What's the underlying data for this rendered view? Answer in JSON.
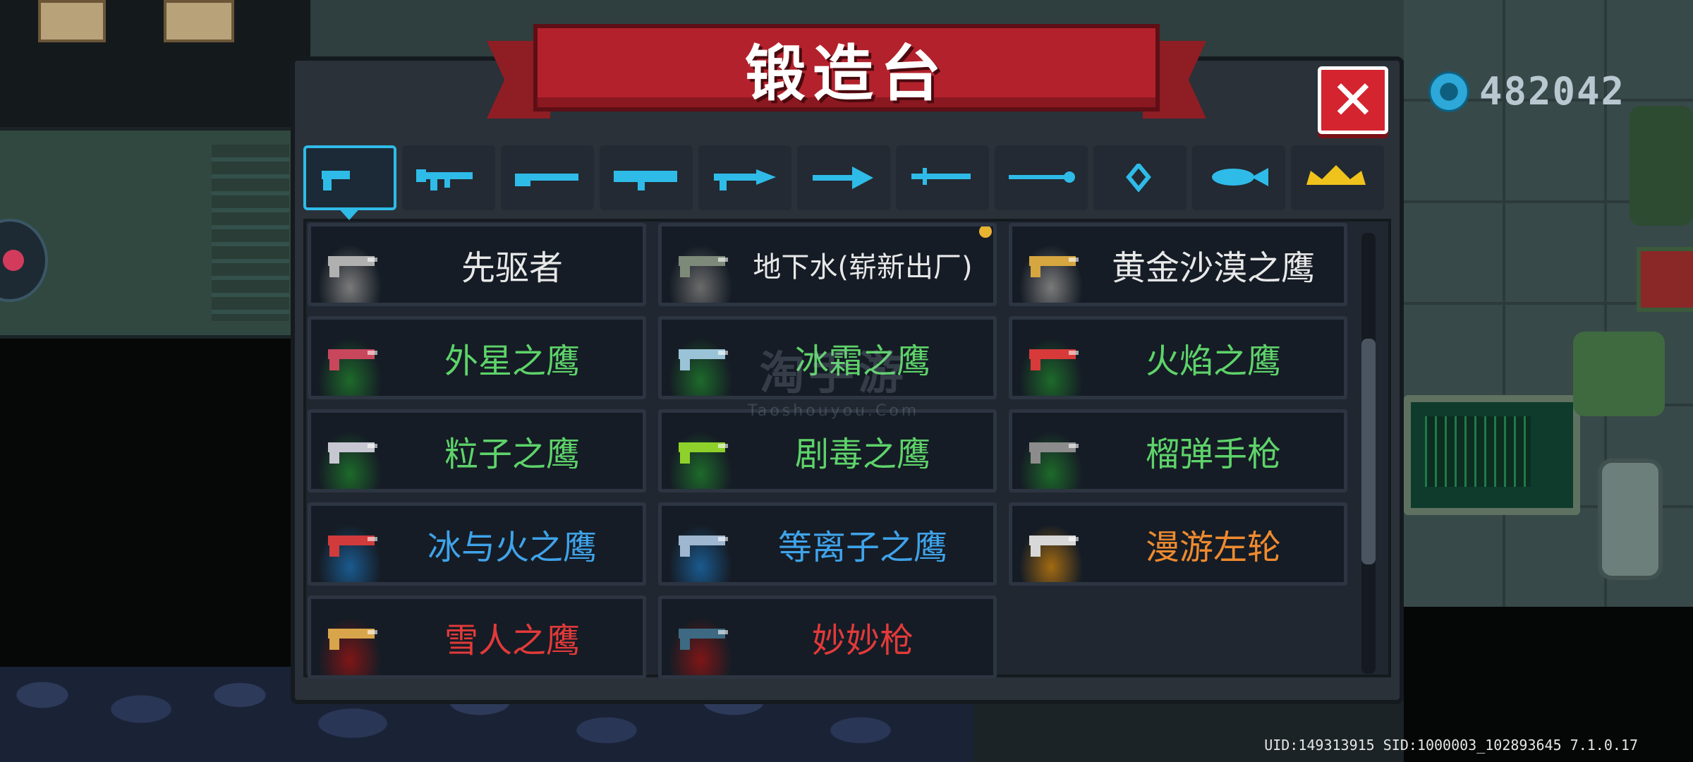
{
  "title": "锻造台",
  "close_symbol": "✕",
  "currency": {
    "icon": "gem-coin-icon",
    "value": "482042"
  },
  "tabs": [
    {
      "icon": "pistol-icon",
      "active": true
    },
    {
      "icon": "assault-rifle-icon",
      "active": false
    },
    {
      "icon": "shotgun-icon",
      "active": false
    },
    {
      "icon": "rocket-launcher-icon",
      "active": false
    },
    {
      "icon": "laser-gun-icon",
      "active": false
    },
    {
      "icon": "bow-icon",
      "active": false
    },
    {
      "icon": "melee-blade-icon",
      "active": false
    },
    {
      "icon": "staff-icon",
      "active": false
    },
    {
      "icon": "shuriken-icon",
      "active": false
    },
    {
      "icon": "fish-icon",
      "active": false
    },
    {
      "icon": "crown-icon",
      "active": false
    }
  ],
  "weapons": [
    {
      "name": "先驱者",
      "tier": "white",
      "gun_color": "#b0b0b0",
      "glow": "#7a7a7a"
    },
    {
      "name": "地下水(崭新出厂)",
      "tier": "white",
      "gun_color": "#7d8a7a",
      "glow": "#6a6a6a",
      "badge": true
    },
    {
      "name": "黄金沙漠之鹰",
      "tier": "white",
      "gun_color": "#d6a640",
      "glow": "#7a7a7a"
    },
    {
      "name": "外星之鹰",
      "tier": "green",
      "gun_color": "#c9475d",
      "glow": "#1d6a2a"
    },
    {
      "name": "冰霜之鹰",
      "tier": "green",
      "gun_color": "#9ac3d8",
      "glow": "#1d6a2a"
    },
    {
      "name": "火焰之鹰",
      "tier": "green",
      "gun_color": "#d83a3a",
      "glow": "#1d6a2a"
    },
    {
      "name": "粒子之鹰",
      "tier": "green",
      "gun_color": "#c7c7d2",
      "glow": "#1d6a2a"
    },
    {
      "name": "剧毒之鹰",
      "tier": "green",
      "gun_color": "#8fd12b",
      "glow": "#1d6a2a"
    },
    {
      "name": "榴弹手枪",
      "tier": "green",
      "gun_color": "#8c8c8c",
      "glow": "#1d6a2a"
    },
    {
      "name": "冰与火之鹰",
      "tier": "blue",
      "gun_color": "#d13b3b",
      "glow": "#1a5a8e"
    },
    {
      "name": "等离子之鹰",
      "tier": "blue",
      "gun_color": "#9fb7d0",
      "glow": "#1a5a8e"
    },
    {
      "name": "漫游左轮",
      "tier": "orange",
      "gun_color": "#d8d8d8",
      "glow": "#a26a12"
    },
    {
      "name": "雪人之鹰",
      "tier": "red",
      "gun_color": "#d9a54b",
      "glow": "#7e1616"
    },
    {
      "name": "妙妙枪",
      "tier": "red",
      "gun_color": "#3d6a82",
      "glow": "#7e1616"
    }
  ],
  "watermark": {
    "main": "淘手游",
    "sub": "Taoshouyou.Com"
  },
  "footer": {
    "uid": "UID:149313915 SID:1000003_102893645 7.1.0.17"
  },
  "colors": {
    "accent": "#2fbbe8",
    "banner": "#b3222c",
    "close": "#d42430",
    "tier_white": "#e8e8e8",
    "tier_green": "#5ed36a",
    "tier_blue": "#3fa3ea",
    "tier_orange": "#ee8a2f",
    "tier_red": "#e23a3a"
  }
}
